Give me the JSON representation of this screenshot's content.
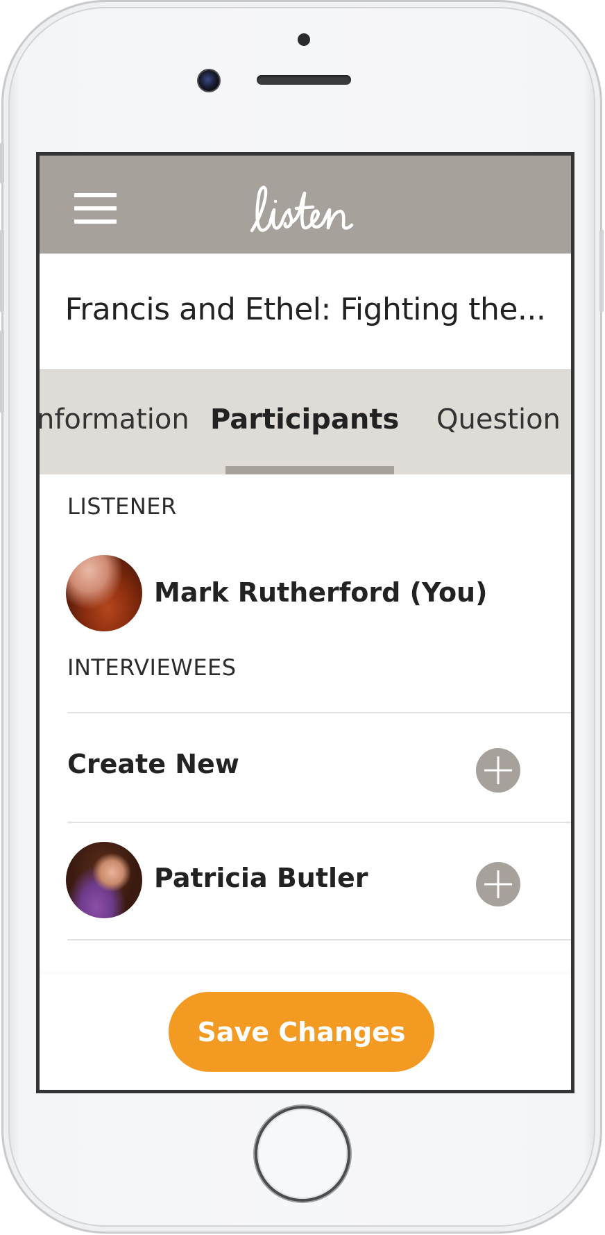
{
  "app": {
    "logo_text": "listen",
    "title": "Francis and Ethel: Fighting the..."
  },
  "tabs": [
    {
      "label": "nformation",
      "active": false
    },
    {
      "label": "Participants",
      "active": true
    },
    {
      "label": "Question",
      "active": false
    }
  ],
  "listener": {
    "section_label": "LISTENER",
    "name": "Mark Rutherford (You)"
  },
  "interviewees": {
    "section_label": "INTERVIEWEES",
    "create_new_label": "Create New",
    "items": [
      {
        "name": "Patricia Butler"
      }
    ]
  },
  "footer": {
    "save_label": "Save Changes"
  },
  "colors": {
    "header_bg": "#a7a19c",
    "tabs_bg": "#dfdbd6",
    "accent": "#f39a23",
    "add_button": "#a7a19c"
  },
  "icons": [
    "hamburger-menu-icon",
    "plus-icon",
    "avatar-image"
  ]
}
